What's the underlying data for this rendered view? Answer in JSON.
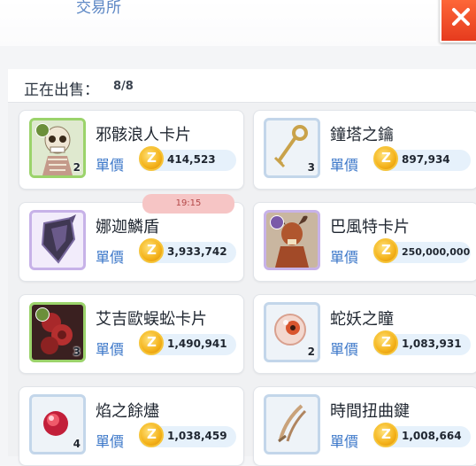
{
  "header": {
    "title": "交易所"
  },
  "section": {
    "label": "正在出售：",
    "count": "8/8"
  },
  "price_label": "單價",
  "timer": "19:15",
  "listings": [
    {
      "name": "邪骸浪人卡片",
      "price": "414,523",
      "qty": "2",
      "icon": "skeleton-card-icon"
    },
    {
      "name": "鐘塔之鑰",
      "price": "897,934",
      "qty": "3",
      "icon": "key-icon"
    },
    {
      "name": "娜迦鱗盾",
      "price": "3,933,742",
      "qty": "",
      "icon": "shield-icon"
    },
    {
      "name": "巴風特卡片",
      "price": "250,000,000",
      "qty": "",
      "icon": "baphomet-card-icon"
    },
    {
      "name": "艾吉歐蜈蚣卡片",
      "price": "1,490,941",
      "qty": "3",
      "icon": "centipede-card-icon"
    },
    {
      "name": "蛇妖之瞳",
      "price": "1,083,931",
      "qty": "2",
      "icon": "eye-orb-icon"
    },
    {
      "name": "焰之餘燼",
      "price": "1,038,459",
      "qty": "4",
      "icon": "ember-icon"
    },
    {
      "name": "時間扭曲鍵",
      "price": "1,008,664",
      "qty": "",
      "icon": "time-twist-icon"
    }
  ],
  "colors": {
    "accent": "#3d78c9",
    "close": "#e63b1e",
    "coin": "#f4b21a"
  }
}
